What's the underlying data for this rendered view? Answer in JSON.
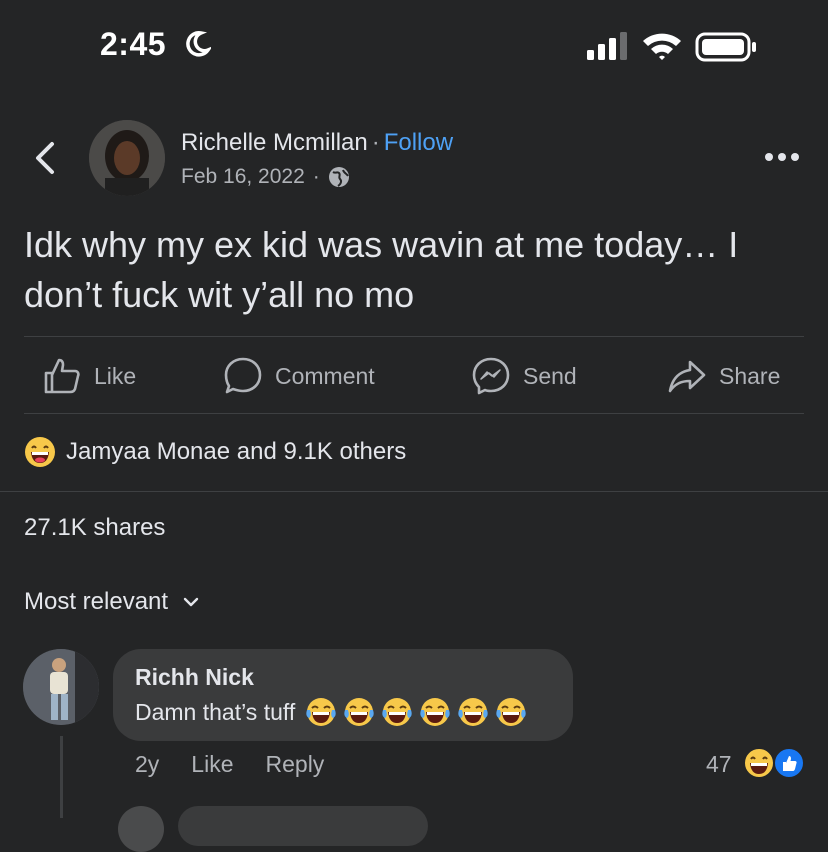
{
  "status_bar": {
    "time": "2:45"
  },
  "post": {
    "author": "Richelle Mcmillan",
    "follow_label": "Follow",
    "separator": "·",
    "date": "Feb 16, 2022",
    "date_separator": "·",
    "text": "Idk why my ex kid was wavin at me today… I don’t fuck wit y’all no mo"
  },
  "actions": [
    {
      "label": "Like",
      "icon": "thumbs-up-icon"
    },
    {
      "label": "Comment",
      "icon": "comment-icon"
    },
    {
      "label": "Send",
      "icon": "messenger-icon"
    },
    {
      "label": "Share",
      "icon": "share-icon"
    }
  ],
  "reactions": {
    "text": "Jamyaa Monae and 9.1K others",
    "icon": "grinning-emoji-icon"
  },
  "shares": "27.1K shares",
  "sort": {
    "label": "Most relevant"
  },
  "comment": {
    "name": "Richh Nick",
    "text": "Damn that’s tuff",
    "emoji_count_shown": 6,
    "time": "2y",
    "like_label": "Like",
    "reply_label": "Reply",
    "reaction_count": "47"
  },
  "colors": {
    "background": "#242526",
    "bubble": "#3a3b3c",
    "accent": "#4ea1f5",
    "muted": "#b0b3b8"
  }
}
